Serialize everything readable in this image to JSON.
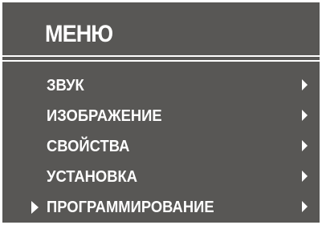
{
  "menu": {
    "title": "МЕНЮ",
    "selected_index": 4,
    "items": [
      {
        "label": "ЗВУК",
        "submenu_icon": "chevron-right-icon"
      },
      {
        "label": "ИЗОБРАЖЕНИЕ",
        "submenu_icon": "chevron-right-icon"
      },
      {
        "label": "СВОЙСТВА",
        "submenu_icon": "chevron-right-icon"
      },
      {
        "label": "УСТАНОВКА",
        "submenu_icon": "chevron-right-icon"
      },
      {
        "label": "ПРОГРАММИРОВАНИЕ",
        "submenu_icon": "chevron-right-icon"
      }
    ]
  },
  "colors": {
    "background": "#585755",
    "text": "#ffffff",
    "page": "#ffffff"
  }
}
